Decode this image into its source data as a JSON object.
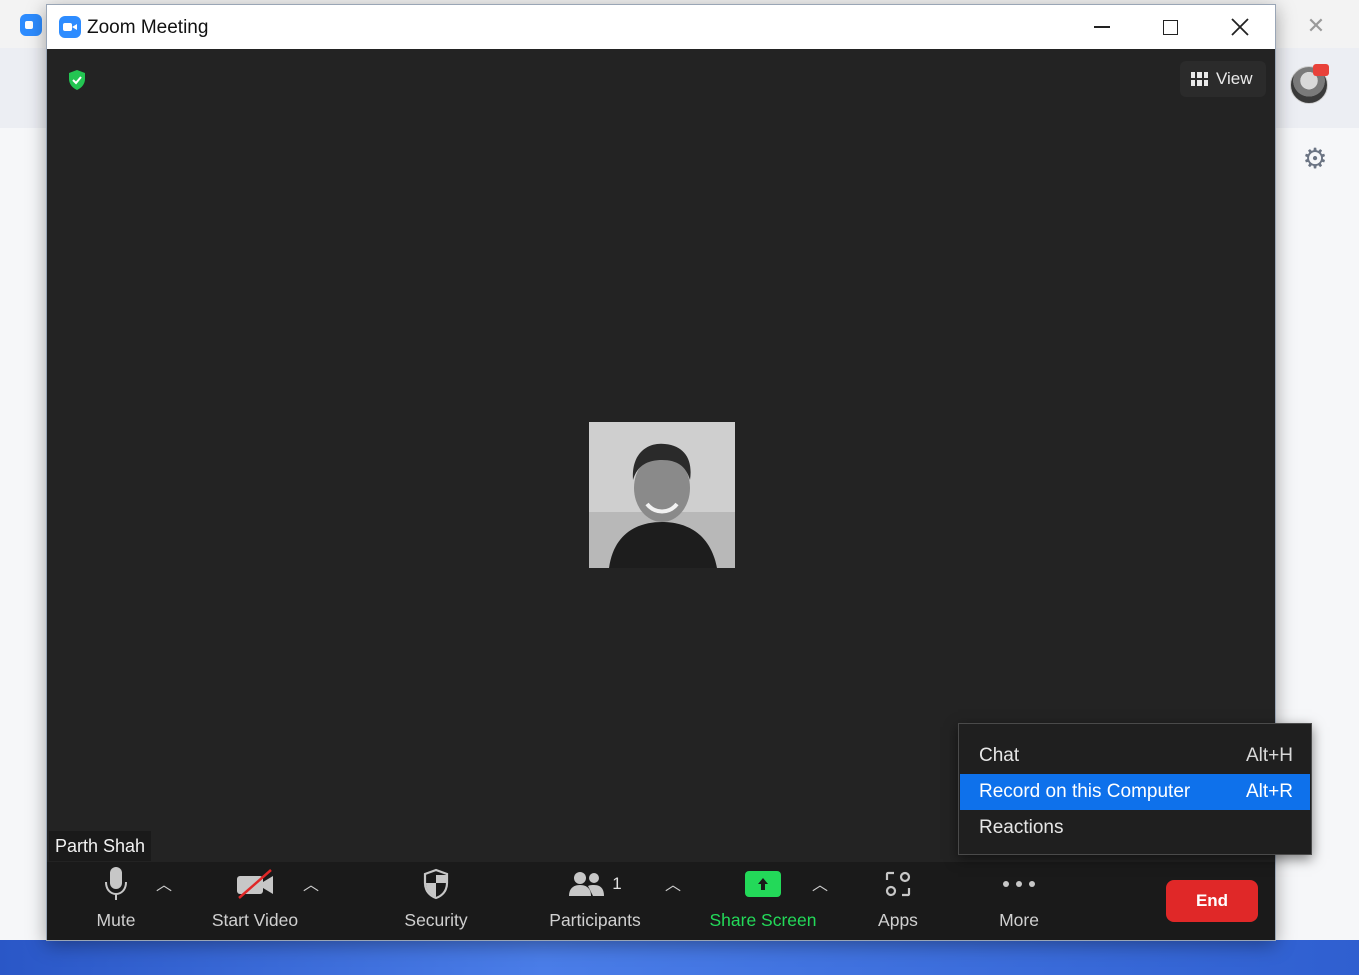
{
  "window": {
    "title": "Zoom Meeting"
  },
  "top_right": {
    "view_label": "View"
  },
  "participant": {
    "name": "Parth Shah"
  },
  "toolbar": {
    "mute_label": "Mute",
    "start_video_label": "Start Video",
    "security_label": "Security",
    "participants_label": "Participants",
    "participants_count": "1",
    "share_screen_label": "Share Screen",
    "apps_label": "Apps",
    "more_label": "More",
    "end_label": "End"
  },
  "more_menu": {
    "items": [
      {
        "label": "Chat",
        "shortcut": "Alt+H"
      },
      {
        "label": "Record on this Computer",
        "shortcut": "Alt+R"
      },
      {
        "label": "Reactions",
        "shortcut": ""
      }
    ]
  },
  "colors": {
    "accent_blue": "#0e71eb",
    "share_green": "#23d959",
    "end_red": "#e02828",
    "video_bg": "#232323"
  }
}
